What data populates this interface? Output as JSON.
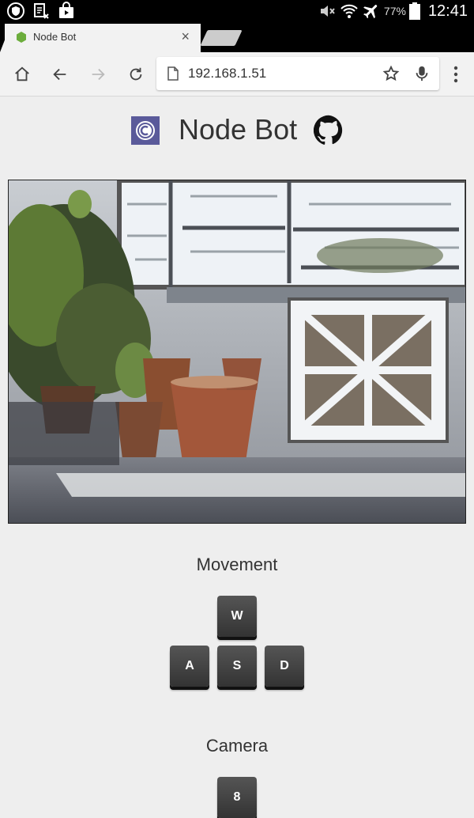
{
  "status_bar": {
    "battery_percent": "77%",
    "time": "12:41"
  },
  "browser": {
    "tab_title": "Node Bot",
    "url": "192.168.1.51"
  },
  "page": {
    "title": "Node Bot",
    "movement": {
      "heading": "Movement",
      "keys": {
        "up": "W",
        "left": "A",
        "down": "S",
        "right": "D"
      }
    },
    "camera": {
      "heading": "Camera",
      "keys": {
        "up": "8"
      }
    }
  },
  "colors": {
    "page_background": "#eeeeee",
    "key_background": "#3a3a3a",
    "logo_background": "#5a5a9a"
  }
}
